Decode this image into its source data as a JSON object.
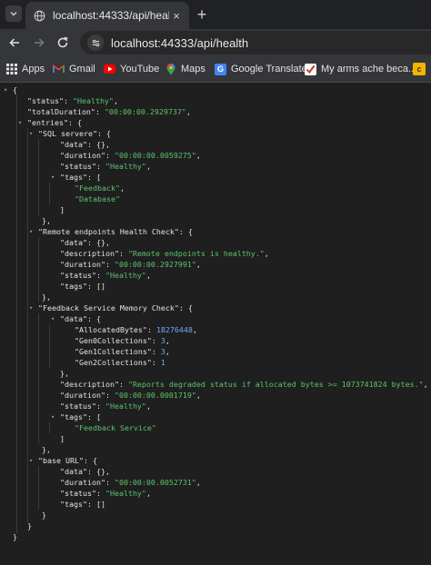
{
  "browser": {
    "tab_title": "localhost:44333/api/health",
    "url": "localhost:44333/api/health",
    "new_tab_symbol": "+",
    "close_symbol": "×",
    "bookmarks": [
      {
        "label": "Apps",
        "icon": "apps-grid-icon"
      },
      {
        "label": "Gmail",
        "icon": "gmail-icon"
      },
      {
        "label": "YouTube",
        "icon": "youtube-icon"
      },
      {
        "label": "Maps",
        "icon": "maps-icon"
      },
      {
        "label": "Google Translate",
        "icon": "translate-icon"
      },
      {
        "label": "My arms ache beca...",
        "icon": "checkmark-icon"
      }
    ]
  },
  "json": {
    "open_brace": "{",
    "close_brace": "}",
    "status_key": "\"status\"",
    "status_val": "\"Healthy\"",
    "total_key": "\"totalDuration\"",
    "total_val": "\"00:00:00.2929737\"",
    "entries_key": "\"entries\"",
    "sql": {
      "key": "\"SQL servere\"",
      "data": "\"data\": {},",
      "duration_key": "\"duration\"",
      "duration_val": "\"00:00:00.0059275\"",
      "status_key": "\"status\"",
      "status_val": "\"Healthy\"",
      "tags_key": "\"tags\"",
      "tags": [
        "\"Feedback\"",
        "\"Database\""
      ]
    },
    "remote": {
      "key": "\"Remote endpoints Health Check\"",
      "data": "\"data\": {},",
      "description_key": "\"description\"",
      "description_val": "\"Remote endpoints is healthy.\"",
      "duration_key": "\"duration\"",
      "duration_val": "\"00:00:00.2927991\"",
      "status_key": "\"status\"",
      "status_val": "\"Healthy\"",
      "tags": "\"tags\": []"
    },
    "feedback": {
      "key": "\"Feedback Service Memory Check\"",
      "data_key": "\"data\"",
      "allocated_key": "\"AllocatedBytes\"",
      "allocated_val": "18276448",
      "gen0_key": "\"Gen0Collections\"",
      "gen0_val": "3",
      "gen1_key": "\"Gen1Collections\"",
      "gen1_val": "3",
      "gen2_key": "\"Gen2Collections\"",
      "gen2_val": "1",
      "description_key": "\"description\"",
      "description_val": "\"Reports degraded status if allocated bytes >= 1073741824 bytes.\"",
      "duration_key": "\"duration\"",
      "duration_val": "\"00:00:00.0001719\"",
      "status_key": "\"status\"",
      "status_val": "\"Healthy\"",
      "tags_key": "\"tags\"",
      "tags": [
        "\"Feedback Service\""
      ]
    },
    "base": {
      "key": "\"base URL\"",
      "data": "\"data\": {},",
      "duration_key": "\"duration\"",
      "duration_val": "\"00:00:00.0052731\"",
      "status_key": "\"status\"",
      "status_val": "\"Healthy\"",
      "tags": "\"tags\": []"
    }
  }
}
